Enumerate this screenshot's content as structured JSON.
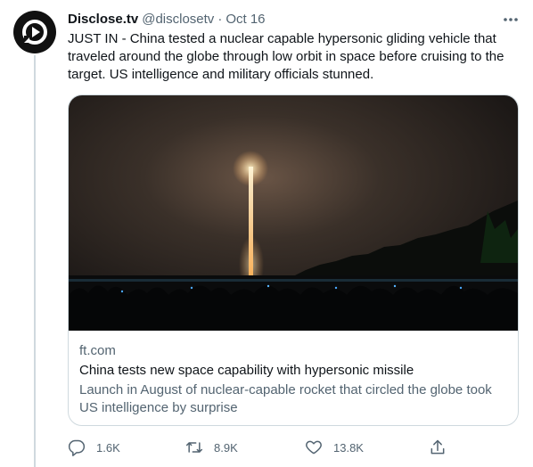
{
  "tweet": {
    "author_name": "Disclose.tv",
    "handle": "@disclosetv",
    "separator": "·",
    "date": "Oct 16",
    "text": "JUST IN - China tested a nuclear capable hypersonic gliding vehicle that traveled around the globe through low orbit in space before cruising to the target. US intelligence and military officials stunned."
  },
  "card": {
    "domain": "ft.com",
    "title": "China tests new space capability with hypersonic missile",
    "description": "Launch in August of nuclear-capable rocket that circled the globe took US intelligence by surprise"
  },
  "actions": {
    "replies": "1.6K",
    "retweets": "8.9K",
    "likes": "13.8K"
  },
  "icons": {
    "avatar": "disclose-tv-logo",
    "more": "more-dots-icon",
    "reply": "reply-icon",
    "retweet": "retweet-icon",
    "like": "heart-icon",
    "share": "share-icon"
  },
  "colors": {
    "text_primary": "#0f1419",
    "text_secondary": "#536471",
    "border": "#cfd9de",
    "avatar_bg": "#111111"
  }
}
